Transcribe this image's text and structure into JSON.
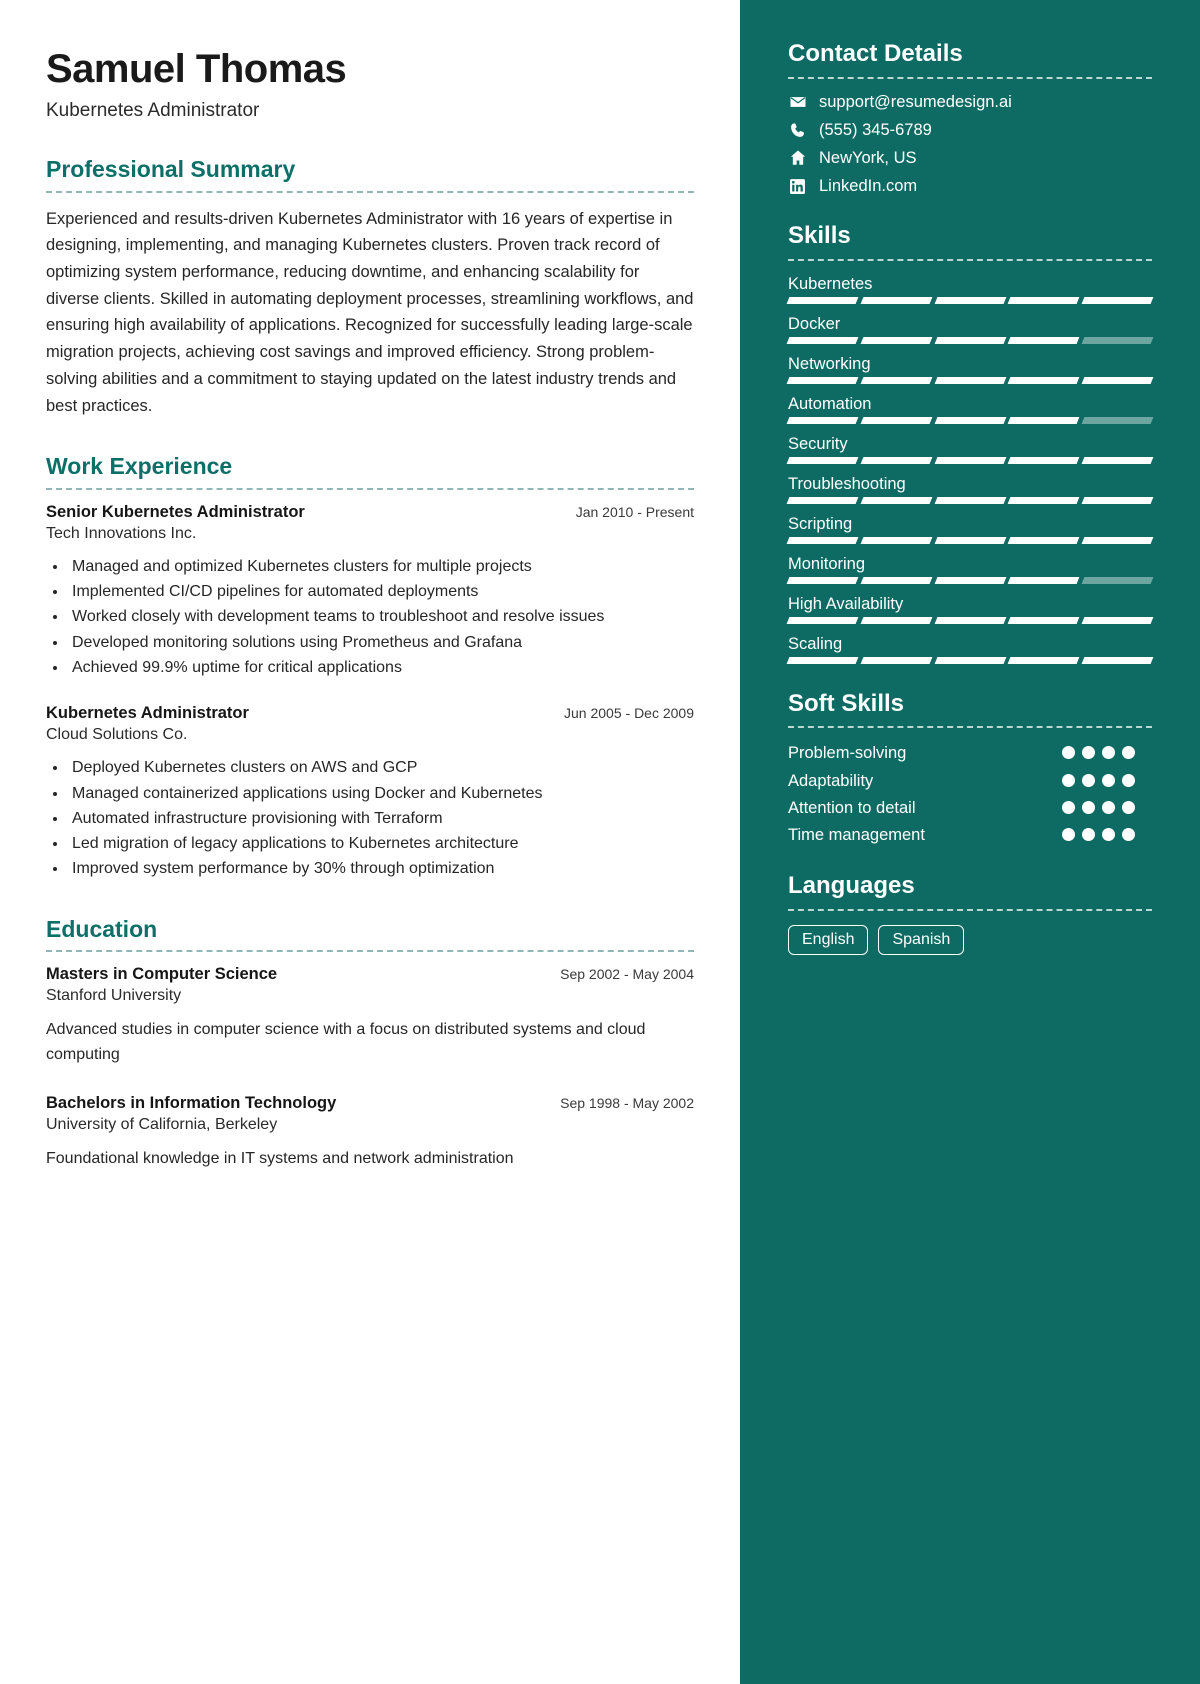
{
  "theme": {
    "accent": "#0d6b63",
    "heading": "#0d7068",
    "sidebar_text": "#ffffff"
  },
  "header": {
    "name": "Samuel Thomas",
    "job_title": "Kubernetes Administrator"
  },
  "summary": {
    "heading": "Professional Summary",
    "text": "Experienced and results-driven Kubernetes Administrator with 16 years of expertise in designing, implementing, and managing Kubernetes clusters. Proven track record of optimizing system performance, reducing downtime, and enhancing scalability for diverse clients. Skilled in automating deployment processes, streamlining workflows, and ensuring high availability of applications. Recognized for successfully leading large-scale migration projects, achieving cost savings and improved efficiency. Strong problem-solving abilities and a commitment to staying updated on the latest industry trends and best practices."
  },
  "work": {
    "heading": "Work Experience",
    "entries": [
      {
        "title": "Senior Kubernetes Administrator",
        "date": "Jan 2010 - Present",
        "org": "Tech Innovations Inc.",
        "bullets": [
          "Managed and optimized Kubernetes clusters for multiple projects",
          "Implemented CI/CD pipelines for automated deployments",
          "Worked closely with development teams to troubleshoot and resolve issues",
          "Developed monitoring solutions using Prometheus and Grafana",
          "Achieved 99.9% uptime for critical applications"
        ]
      },
      {
        "title": "Kubernetes Administrator",
        "date": "Jun 2005 - Dec 2009",
        "org": "Cloud Solutions Co.",
        "bullets": [
          "Deployed Kubernetes clusters on AWS and GCP",
          "Managed containerized applications using Docker and Kubernetes",
          "Automated infrastructure provisioning with Terraform",
          "Led migration of legacy applications to Kubernetes architecture",
          "Improved system performance by 30% through optimization"
        ]
      }
    ]
  },
  "education": {
    "heading": "Education",
    "entries": [
      {
        "degree": "Masters in Computer Science",
        "date": "Sep 2002 - May 2004",
        "school": "Stanford University",
        "description": "Advanced studies in computer science with a focus on distributed systems and cloud computing"
      },
      {
        "degree": "Bachelors in Information Technology",
        "date": "Sep 1998 - May 2002",
        "school": "University of California, Berkeley",
        "description": "Foundational knowledge in IT systems and network administration"
      }
    ]
  },
  "contact": {
    "heading": "Contact Details",
    "items": [
      {
        "icon": "envelope-icon",
        "value": "support@resumedesign.ai"
      },
      {
        "icon": "phone-icon",
        "value": "(555) 345-6789"
      },
      {
        "icon": "home-icon",
        "value": "NewYork, US"
      },
      {
        "icon": "linkedin-icon",
        "value": "LinkedIn.com"
      }
    ]
  },
  "skills": {
    "heading": "Skills",
    "total_segments": 5,
    "items": [
      {
        "name": "Kubernetes",
        "filled": 5
      },
      {
        "name": "Docker",
        "filled": 4
      },
      {
        "name": "Networking",
        "filled": 5
      },
      {
        "name": "Automation",
        "filled": 4
      },
      {
        "name": "Security",
        "filled": 5
      },
      {
        "name": "Troubleshooting",
        "filled": 5
      },
      {
        "name": "Scripting",
        "filled": 5
      },
      {
        "name": "Monitoring",
        "filled": 4
      },
      {
        "name": "High Availability",
        "filled": 5
      },
      {
        "name": "Scaling",
        "filled": 5
      }
    ]
  },
  "soft_skills": {
    "heading": "Soft Skills",
    "total_dots": 4,
    "items": [
      {
        "name": "Problem-solving",
        "filled": 4
      },
      {
        "name": "Adaptability",
        "filled": 4
      },
      {
        "name": "Attention to detail",
        "filled": 4
      },
      {
        "name": "Time management",
        "filled": 4
      }
    ]
  },
  "languages": {
    "heading": "Languages",
    "items": [
      "English",
      "Spanish"
    ]
  }
}
